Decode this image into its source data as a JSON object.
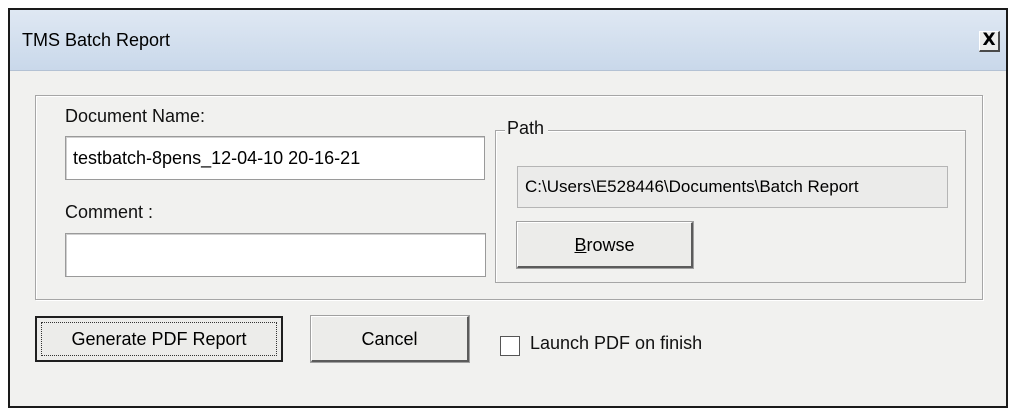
{
  "window": {
    "title": "TMS Batch Report",
    "close_label": "X"
  },
  "document_name": {
    "label": "Document Name:",
    "value": "testbatch-8pens_12-04-10 20-16-21"
  },
  "comment": {
    "label": "Comment :",
    "value": ""
  },
  "path": {
    "legend": "Path",
    "value": "C:\\Users\\E528446\\Documents\\Batch Report",
    "browse_label_prefix": "",
    "browse_label_mnemonic": "B",
    "browse_label_rest": "rowse"
  },
  "actions": {
    "generate_label": "Generate PDF Report",
    "cancel_label": "Cancel",
    "launch_checkbox_label": "Launch PDF on finish",
    "launch_checked": false
  }
}
